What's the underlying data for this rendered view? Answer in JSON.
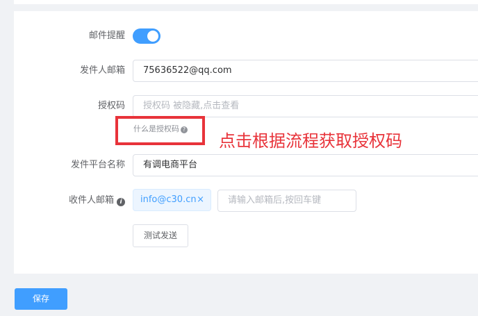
{
  "form": {
    "mail_alert": {
      "label": "邮件提醒",
      "enabled": true
    },
    "sender_email": {
      "label": "发件人邮箱",
      "value": "75636522@qq.com"
    },
    "auth_code": {
      "label": "授权码",
      "placeholder": "授权码 被隐藏,点击查看",
      "hint": "什么是授权码",
      "hint_icon": "question-circle-icon"
    },
    "platform_name": {
      "label": "发件平台名称",
      "value": "有调电商平台"
    },
    "recipient_email": {
      "label": "收件人邮箱",
      "info_icon": "info-circle-icon",
      "tags": [
        "info@c30.cn"
      ],
      "tag_close": "×",
      "placeholder": "请输入邮箱后,按回车键"
    },
    "test_button": "测试发送"
  },
  "annotation": "点击根据流程获取授权码",
  "save_button": "保存",
  "colors": {
    "primary": "#409eff",
    "annotation_red": "#e8333a",
    "background": "#f0f2f5"
  }
}
